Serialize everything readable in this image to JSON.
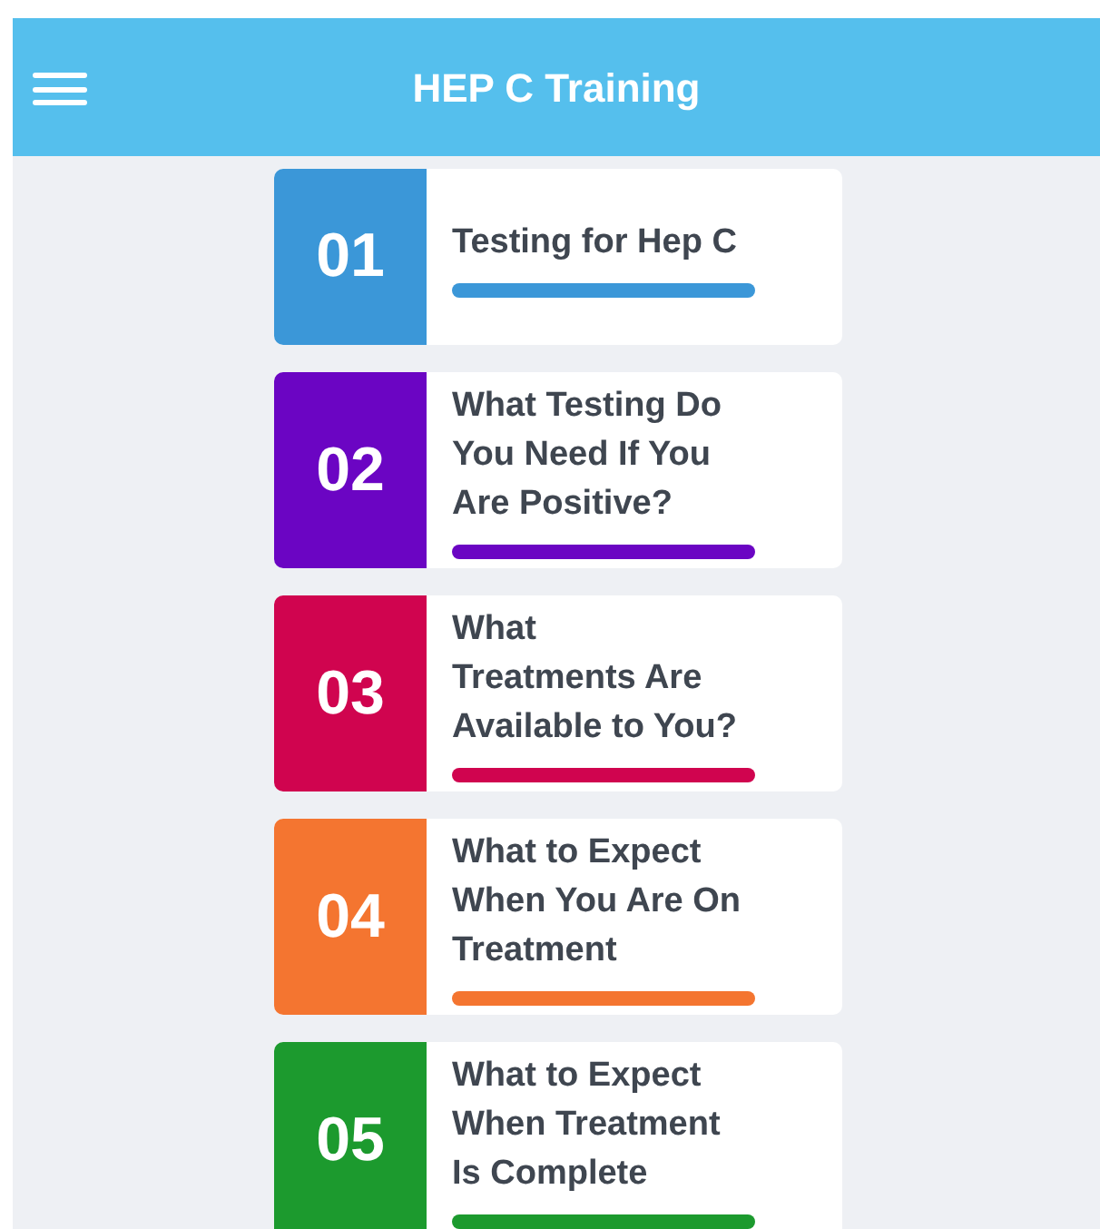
{
  "header": {
    "title": "HEP C Training"
  },
  "modules": [
    {
      "number": "01",
      "title_lines": [
        "Testing for Hep C"
      ],
      "color": "#3b97d8"
    },
    {
      "number": "02",
      "title_lines": [
        "What Testing Do",
        "You Need If You",
        "Are Positive?"
      ],
      "color": "#6b05c3"
    },
    {
      "number": "03",
      "title_lines": [
        "What",
        "Treatments Are",
        "Available to You?"
      ],
      "color": "#d0044f"
    },
    {
      "number": "04",
      "title_lines": [
        "What to Expect",
        "When You Are On",
        "Treatment"
      ],
      "color": "#f47530"
    },
    {
      "number": "05",
      "title_lines": [
        "What to Expect",
        "When Treatment",
        "Is Complete"
      ],
      "color": "#1c9a2e"
    }
  ]
}
